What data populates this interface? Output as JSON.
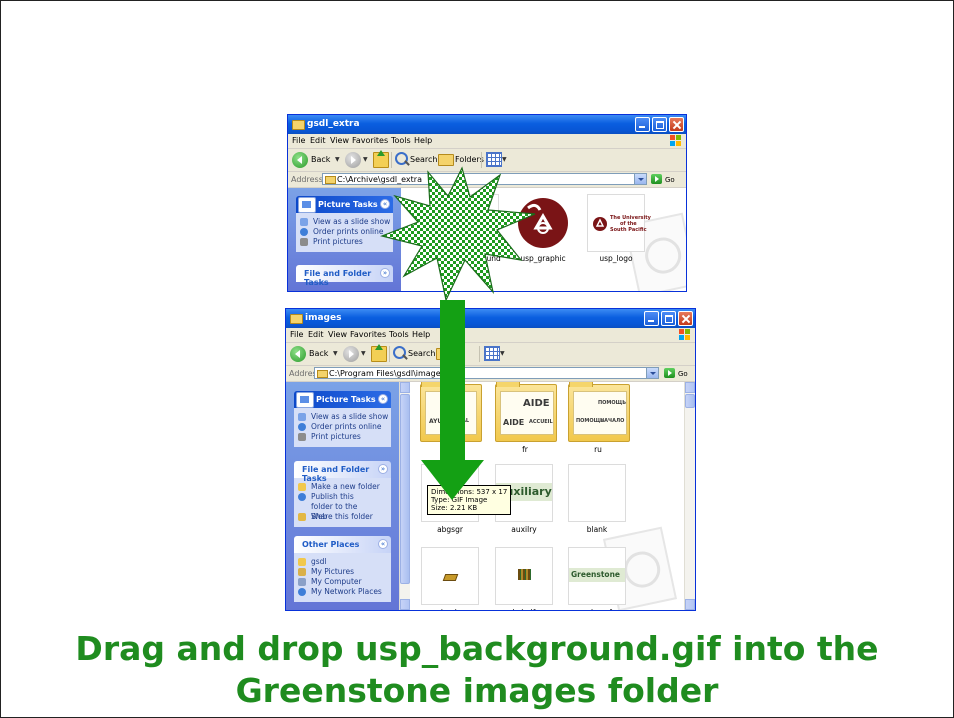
{
  "colors": {
    "caption_green": "#1f8c1f",
    "xp_titlebar_blue": "#0a5ee0",
    "arrow_green": "#14a014",
    "tooltip_yellow": "#ffffe1"
  },
  "top_window": {
    "title": "gsdl_extra",
    "menu": [
      "File",
      "Edit",
      "View",
      "Favorites",
      "Tools",
      "Help"
    ],
    "toolbar": {
      "back": "Back",
      "search": "Search",
      "folders": "Folders"
    },
    "address_label": "Address",
    "address_value": "C:\\Archive\\gsdl_extra",
    "go": "Go",
    "picture_tasks": {
      "title": "Picture Tasks",
      "items": [
        "View as a slide show",
        "Order prints online",
        "Print pictures"
      ]
    },
    "file_folder_tasks_title": "File and Folder Tasks",
    "files": [
      {
        "name": "usp_background",
        "icon": "usp-background-icon"
      },
      {
        "name": "usp_graphic",
        "icon": "usp-graphic-icon"
      },
      {
        "name": "usp_logo",
        "icon": "usp-logo-icon",
        "logo_text": [
          "The University",
          "of the",
          "South Pacific"
        ]
      }
    ]
  },
  "bottom_window": {
    "title": "images",
    "menu": [
      "File",
      "Edit",
      "View",
      "Favorites",
      "Tools",
      "Help"
    ],
    "toolbar": {
      "back": "Back",
      "search": "Search"
    },
    "address_label": "Address",
    "address_value": "C:\\Program Files\\gsdl\\images",
    "go": "Go",
    "picture_tasks": {
      "title": "Picture Tasks",
      "items": [
        "View as a slide show",
        "Order prints online",
        "Print pictures"
      ]
    },
    "file_folder_tasks": {
      "title": "File and Folder Tasks",
      "items": [
        "Make a new folder",
        "Publish this folder to the Web",
        "Share this folder"
      ]
    },
    "other_places": {
      "title": "Other Places",
      "items": [
        "gsdl",
        "My Pictures",
        "My Computer",
        "My Network Places"
      ]
    },
    "folders": [
      {
        "name": "",
        "card_texts": [
          "A",
          "AYUD",
          "AL"
        ]
      },
      {
        "name": "fr",
        "card_texts": [
          "AIDE",
          "AIDE",
          "ACCUEIL"
        ]
      },
      {
        "name": "ru",
        "card_texts": [
          "ПОМОЩЬ",
          "ПОМОЩЬ",
          "НАЧАЛО"
        ]
      }
    ],
    "files": [
      {
        "name": "abgsgr",
        "icon": "abgsgr-icon"
      },
      {
        "name": "auxilry",
        "icon": "auxilry-icon",
        "preview_text": "Auxiliary"
      },
      {
        "name": "blank",
        "icon": "blank-icon"
      },
      {
        "name": "book",
        "icon": "book-icon"
      },
      {
        "name": "bshelf",
        "icon": "bshelf-icon"
      },
      {
        "name": "cgbacgf",
        "icon": "cgbacgf-icon",
        "preview_text": "Greenstone"
      }
    ],
    "tooltip": {
      "dimensions": "Dimensions: 537 x 17",
      "type": "Type: GIF Image",
      "size": "Size: 2.21 KB"
    }
  },
  "caption": {
    "line1": "Drag and drop usp_background.gif into the",
    "line2": "Greenstone images folder"
  }
}
